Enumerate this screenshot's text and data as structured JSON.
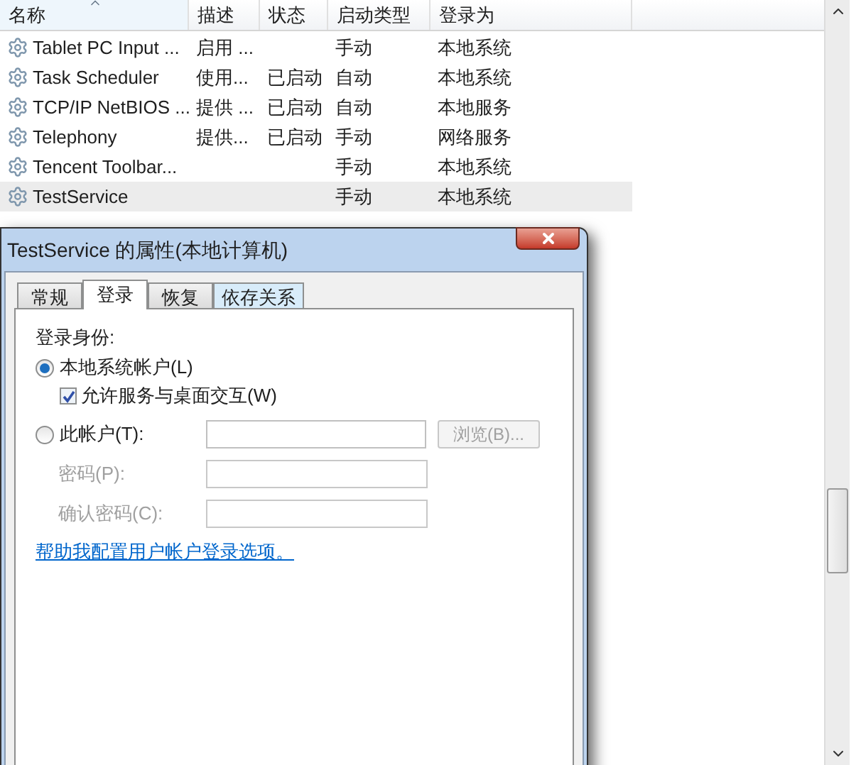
{
  "table": {
    "columns": [
      "名称",
      "描述",
      "状态",
      "启动类型",
      "登录为"
    ],
    "rows": [
      {
        "cells": [
          "Tablet PC Input ...",
          "启用 ...",
          "",
          "手动",
          "本地系统"
        ],
        "selected": false
      },
      {
        "cells": [
          "Task Scheduler",
          "使用...",
          "已启动",
          "自动",
          "本地系统"
        ],
        "selected": false
      },
      {
        "cells": [
          "TCP/IP NetBIOS ...",
          "提供 ...",
          "已启动",
          "自动",
          "本地服务"
        ],
        "selected": false
      },
      {
        "cells": [
          "Telephony",
          "提供...",
          "已启动",
          "手动",
          "网络服务"
        ],
        "selected": false
      },
      {
        "cells": [
          "Tencent Toolbar...",
          "",
          "",
          "手动",
          "本地系统"
        ],
        "selected": false
      },
      {
        "cells": [
          "TestService",
          "",
          "",
          "手动",
          "本地系统"
        ],
        "selected": true
      }
    ]
  },
  "dialog": {
    "title": "TestService 的属性(本地计算机)",
    "tabs": [
      {
        "label": "常规",
        "selected": false
      },
      {
        "label": "登录",
        "selected": true
      },
      {
        "label": "恢复",
        "selected": false
      },
      {
        "label": "依存关系",
        "selected": false
      }
    ],
    "section_label": "登录身份:",
    "local_system": {
      "label": "本地系统帐户(L)",
      "selected": true
    },
    "interact": {
      "label": "允许服务与桌面交互(W)",
      "checked": true
    },
    "this_account": {
      "label": "此帐户(T):",
      "selected": false
    },
    "browse_button": {
      "label": "浏览(B)...",
      "disabled": true
    },
    "fields": [
      {
        "label": "密码(P):",
        "disabled": true
      },
      {
        "label": "确认密码(C):",
        "disabled": true
      }
    ],
    "help_link": "帮助我配置用户帐户登录选项。"
  }
}
